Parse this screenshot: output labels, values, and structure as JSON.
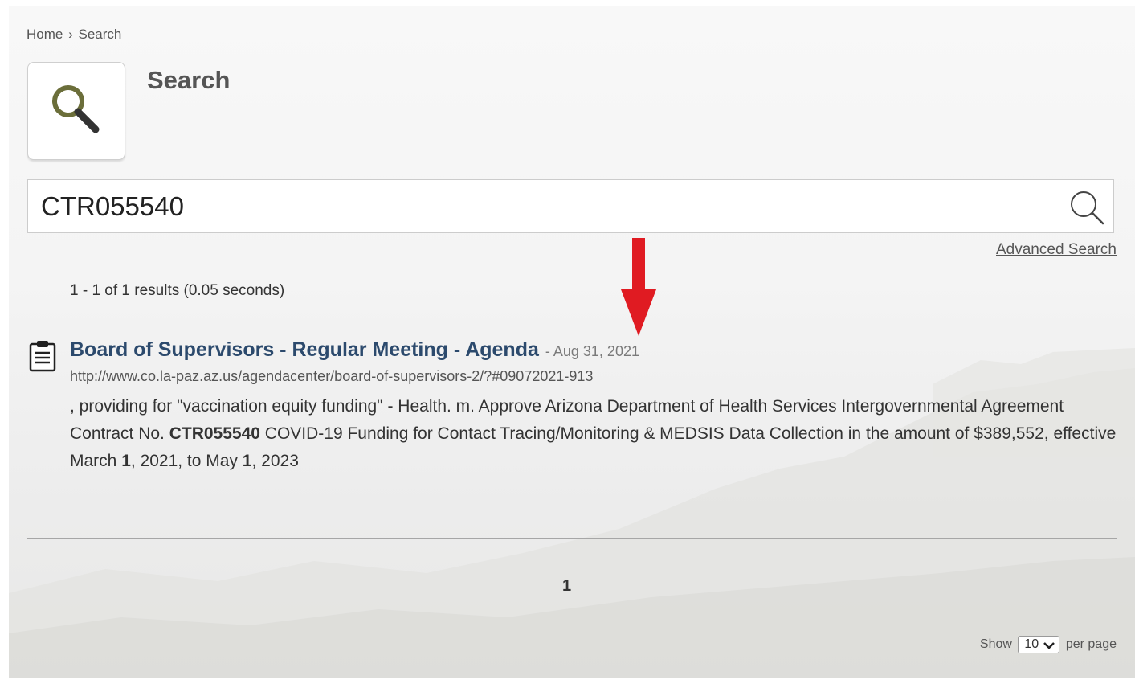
{
  "breadcrumb": {
    "home": "Home",
    "separator": "›",
    "current": "Search"
  },
  "page": {
    "title": "Search",
    "icon": "magnifier-icon"
  },
  "search": {
    "value": "CTR055540",
    "submit_icon": "search-icon",
    "advanced_link": "Advanced Search"
  },
  "annotation": {
    "icon": "red-down-arrow-icon",
    "color": "#e01b22"
  },
  "results": {
    "summary": "1 - 1 of 1 results (0.05 seconds)",
    "items": [
      {
        "icon": "clipboard-document-icon",
        "title": "Board of Supervisors - Regular Meeting - Agenda",
        "date": "- Aug 31, 2021",
        "url": "http://www.co.la-paz.az.us/agendacenter/board-of-supervisors-2/?#09072021-913",
        "snippet": {
          "part1": ", providing for \"vaccination equity funding\" - Health.   m. Approve Arizona Department of Health Services Intergovernmental Agreement Contract No. ",
          "bold1": "CTR055540",
          "part2": " COVID-19 Funding for Contact Tracing/Monitoring & MEDSIS Data Collection in the amount of $389,552, effective March ",
          "bold2": "1",
          "part3": ", 2021, to May ",
          "bold3": "1",
          "part4": ", 2023"
        }
      }
    ]
  },
  "pagination": {
    "current_page": "1"
  },
  "per_page": {
    "label_before": "Show",
    "value": "10",
    "label_after": "per page"
  },
  "colors": {
    "title_link": "#2c4a6d",
    "accent_arrow": "#e01b22",
    "icon_green": "#6b6e3a"
  }
}
